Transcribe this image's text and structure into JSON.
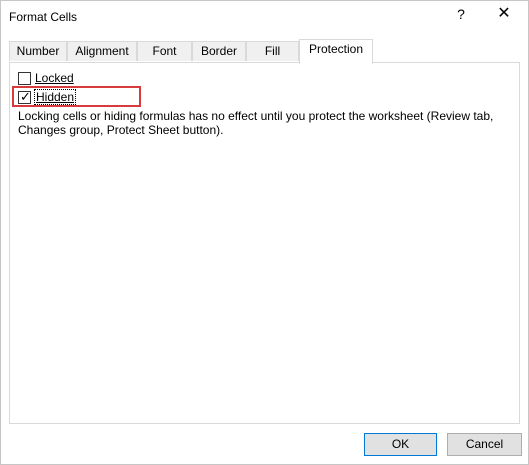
{
  "window": {
    "title": "Format Cells",
    "help_glyph": "?",
    "close_glyph": "✕"
  },
  "tabs": [
    {
      "label": "Number",
      "active": false
    },
    {
      "label": "Alignment",
      "active": false
    },
    {
      "label": "Font",
      "active": false
    },
    {
      "label": "Border",
      "active": false
    },
    {
      "label": "Fill",
      "active": false
    },
    {
      "label": "Protection",
      "active": true
    }
  ],
  "protection": {
    "locked": {
      "label": "Locked",
      "checked": false
    },
    "hidden": {
      "label": "Hidden",
      "checked": true,
      "highlight_color": "#d83b3b"
    },
    "info_text": "Locking cells or hiding formulas has no effect until you protect the worksheet (Review tab, Changes group, Protect Sheet button)."
  },
  "buttons": {
    "ok": "OK",
    "cancel": "Cancel"
  },
  "colors": {
    "accent": "#0078d7",
    "highlight": "#d83b3b"
  }
}
